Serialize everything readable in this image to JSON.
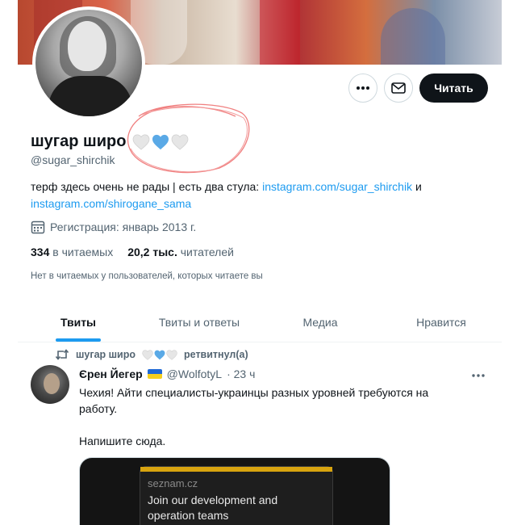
{
  "profile": {
    "name": "шугар широ",
    "handle": "@sugar_shirchik",
    "bio_text": "терф здесь очень не рады | есть два стула: ",
    "bio_link1": "instagram.com/sugar_shirchik",
    "bio_and": " и",
    "bio_link2": "instagram.com/shirogane_sama",
    "joined": "Регистрация: январь 2013 г.",
    "following_count": "334",
    "following_label": "в читаемых",
    "followers_count": "20,2 тыс.",
    "followers_label": "читателей",
    "no_common": "Нет в читаемых у пользователей, которых читаете вы",
    "follow_button": "Читать",
    "heart_colors": [
      "#e6e6e6",
      "#5aa9e6",
      "#e6e6e6"
    ]
  },
  "tabs": [
    {
      "label": "Твиты",
      "active": true
    },
    {
      "label": "Твиты и ответы",
      "active": false
    },
    {
      "label": "Медиа",
      "active": false
    },
    {
      "label": "Нравится",
      "active": false
    }
  ],
  "tweet": {
    "retweeter": "шугар широ",
    "retweet_label": "ретвитнул(а)",
    "author": "Єрен Йегер",
    "author_handle": "@WolfotyL",
    "time": "· 23 ч",
    "text_line1": "Чехия! Айти специалисты-украинцы разных уровней требуются на работу.",
    "text_line2": "Напишите сюда.",
    "media_domain": "seznam.cz",
    "media_headline": "Join our development and operation teams"
  },
  "colors": {
    "accent": "#1d9bf0",
    "annotation": "#f08080"
  }
}
